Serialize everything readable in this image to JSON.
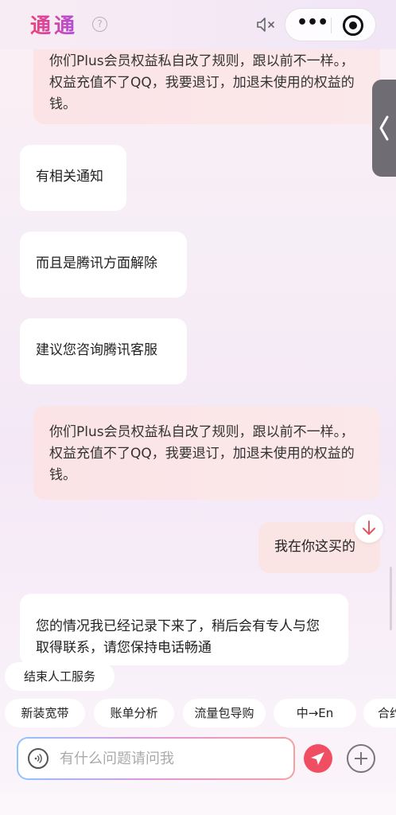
{
  "header": {
    "title": "通通",
    "help_symbol": "?",
    "more_symbol": "•••",
    "icons": [
      "help-icon",
      "mute-icon",
      "more-icon",
      "target-icon"
    ]
  },
  "messages": [
    {
      "role": "user-quote",
      "text": "你们Plus会员权益私自改了规则，跟以前不一样。，权益充值不了QQ，我要退订，加退未使用的权益的钱。"
    },
    {
      "role": "bot",
      "text": "有相关通知"
    },
    {
      "role": "bot",
      "text": "而且是腾讯方面解除"
    },
    {
      "role": "bot",
      "text": "建议您咨询腾讯客服"
    },
    {
      "role": "user-quote",
      "text": "你们Plus会员权益私自改了规则，跟以前不一样。，权益充值不了QQ，我要退订，加退未使用的权益的钱。"
    },
    {
      "role": "user",
      "text": "我在你这买的"
    },
    {
      "role": "bot",
      "text": "您的情况我已经记录下来了，稍后会有专人与您取得联系，请您保持电话畅通"
    }
  ],
  "end_service_label": "结束人工服务",
  "quick_chips": [
    "新装宽带",
    "账单分析",
    "流量包导购",
    "中→En",
    "合约"
  ],
  "input": {
    "placeholder": "有什么问题请问我",
    "value": ""
  },
  "colors": {
    "accent": "#f04e63",
    "title_gradient_start": "#f0407a",
    "title_gradient_end": "#b04ee0",
    "quote_bg": "#fbe3e6",
    "bot_bg": "#ffffff"
  }
}
